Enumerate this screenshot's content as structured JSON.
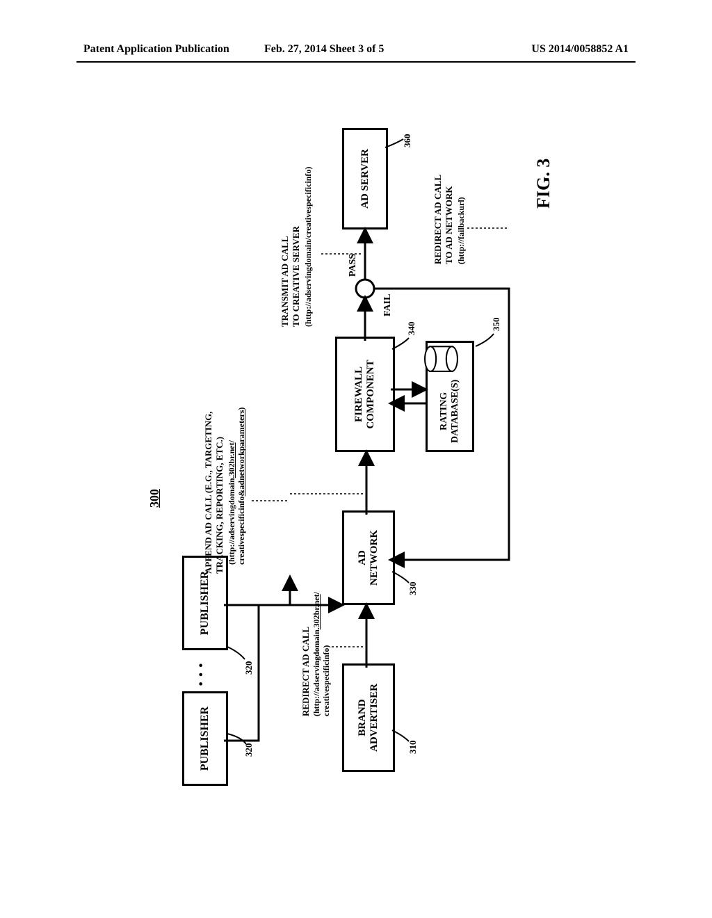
{
  "header": {
    "left": "Patent Application Publication",
    "center": "Feb. 27, 2014  Sheet 3 of 5",
    "right": "US 2014/0058852 A1"
  },
  "ref": "300",
  "boxes": {
    "publisher": "PUBLISHER",
    "brand_advertiser": "BRAND\nADVERTISER",
    "ad_network": "AD\nNETWORK",
    "firewall_component": "FIREWALL\nCOMPONENT",
    "rating_db": "RATING\nDATABASE(S)",
    "ad_server": "AD SERVER"
  },
  "numbers": {
    "publisher_left": "320",
    "publisher_right": "320",
    "brand_advertiser": "310",
    "ad_network": "330",
    "firewall": "340",
    "rating_db": "350",
    "ad_server": "360"
  },
  "annotations": {
    "redirect_to_network": {
      "title": "REDIRECT AD CALL",
      "url_line1": "(http://adservingdomain.302br.net/",
      "url_line2": "creativespecificinfo)"
    },
    "append_ad_call": {
      "title": "APPEND AD CALL (E.G., TARGETING,\nTRACKING, REPORTING, ETC.)",
      "url_line1": "(http://adservingdomain.302br.net/",
      "url_line2": "creativespecificinfo&adnetworkparameters)"
    },
    "transmit_to_creative": {
      "title": "TRANSMIT AD CALL\nTO CREATIVE SERVER",
      "url": "(http://adservingdomain/creativespecificinfo)"
    },
    "redirect_fail": {
      "title": "REDIRECT AD CALL\nTO AD NETWORK",
      "url": "(http://failbackurl)"
    },
    "pass": "PASS",
    "fail": "FAIL"
  },
  "figure": "FIG. 3"
}
